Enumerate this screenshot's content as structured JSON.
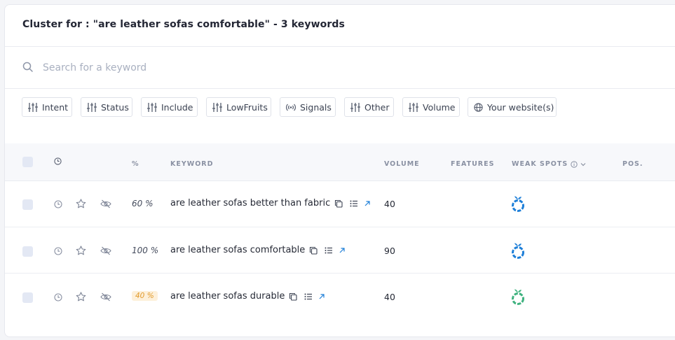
{
  "header": {
    "title": "Cluster for : \"are leather sofas comfortable\" - 3 keywords"
  },
  "search": {
    "placeholder": "Search for a keyword",
    "value": ""
  },
  "filters": [
    {
      "label": "Intent",
      "icon": "sliders-icon"
    },
    {
      "label": "Status",
      "icon": "sliders-icon"
    },
    {
      "label": "Include",
      "icon": "sliders-icon"
    },
    {
      "label": "LowFruits",
      "icon": "sliders-icon"
    },
    {
      "label": "Signals",
      "icon": "signal-icon"
    },
    {
      "label": "Other",
      "icon": "sliders-icon"
    },
    {
      "label": "Volume",
      "icon": "sliders-icon"
    },
    {
      "label": "Your website(s)",
      "icon": "globe-icon"
    }
  ],
  "table": {
    "columns": {
      "percent": "%",
      "keyword": "KEYWORD",
      "volume": "VOLUME",
      "features": "FEATURES",
      "weak_spots": "WEAK SPOTS",
      "position": "POS."
    },
    "rows": [
      {
        "percent": "60 %",
        "percent_style": "plain",
        "keyword": "are leather sofas better than fabric",
        "volume": "40",
        "weak_spot_color": "#1e7fd8"
      },
      {
        "percent": "100 %",
        "percent_style": "plain",
        "keyword": "are leather sofas comfortable",
        "volume": "90",
        "weak_spot_color": "#1e7fd8"
      },
      {
        "percent": "40 %",
        "percent_style": "badge",
        "keyword": "are leather sofas durable",
        "volume": "40",
        "weak_spot_color": "#3fb27f"
      }
    ]
  },
  "colors": {
    "accent": "#1e7fd8",
    "fruit_green": "#3fb27f",
    "badge_bg": "#fdf0da",
    "badge_text": "#e19a2b"
  }
}
